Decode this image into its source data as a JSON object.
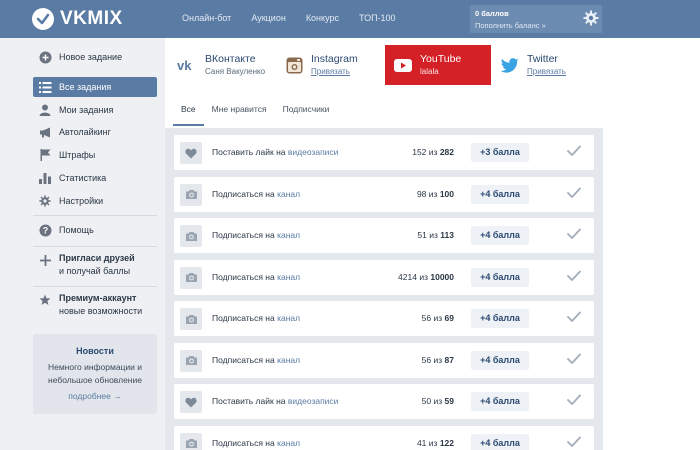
{
  "brand": {
    "name": "VKMIX",
    "color": "#5a7ba3"
  },
  "topnav": [
    "Онлайн-бот",
    "Аукцион",
    "Конкурс",
    "ТОП-100"
  ],
  "balance": {
    "title": "0 баллов",
    "link": "Пополнить баланс »"
  },
  "sidebar": {
    "items": [
      {
        "label": "Новое задание",
        "icon": "plus-circle-icon"
      },
      {
        "label": "Все задания",
        "icon": "list-icon",
        "active": true
      },
      {
        "label": "Мои задания",
        "icon": "user-icon"
      },
      {
        "label": "Автолайкинг",
        "icon": "megaphone-icon"
      },
      {
        "label": "Штрафы",
        "icon": "flag-icon"
      },
      {
        "label": "Статистика",
        "icon": "bar-chart-icon"
      },
      {
        "label": "Настройки",
        "icon": "gear-icon"
      }
    ],
    "help": "Помощь",
    "invite": {
      "title": "Пригласи друзей",
      "subtitle": "и получай баллы"
    },
    "premium": {
      "title": "Премиум-аккаунт",
      "subtitle": "новые возможности"
    },
    "news": {
      "title": "Новости",
      "text": "Немного информации и небольшое обновление",
      "more": "подробнее →"
    }
  },
  "platforms": [
    {
      "name": "ВКонтакте",
      "sub": "Саня Вакуленко",
      "icon": "vk-icon"
    },
    {
      "name": "Instagram",
      "sub": "Привязать",
      "icon": "instagram-icon"
    },
    {
      "name": "YouTube",
      "sub": "lalala",
      "icon": "youtube-icon",
      "active": true
    },
    {
      "name": "Twitter",
      "sub": "Привязать",
      "icon": "twitter-icon"
    }
  ],
  "filters": [
    "Все",
    "Мне нравится",
    "Подписчики"
  ],
  "tasks": [
    {
      "icon": "heart-icon",
      "action": "Поставить лайк на",
      "target": "видеозаписи",
      "done": "152",
      "sep": "из",
      "total": "282",
      "reward": "+3 балла"
    },
    {
      "icon": "camera-icon",
      "action": "Подписаться на",
      "target": "канал",
      "done": "98",
      "sep": "из",
      "total": "100",
      "reward": "+4 балла"
    },
    {
      "icon": "camera-icon",
      "action": "Подписаться на",
      "target": "канал",
      "done": "51",
      "sep": "из",
      "total": "113",
      "reward": "+4 балла"
    },
    {
      "icon": "camera-icon",
      "action": "Подписаться на",
      "target": "канал",
      "done": "4214",
      "sep": "из",
      "total": "10000",
      "reward": "+4 балла"
    },
    {
      "icon": "camera-icon",
      "action": "Подписаться на",
      "target": "канал",
      "done": "56",
      "sep": "из",
      "total": "69",
      "reward": "+4 балла"
    },
    {
      "icon": "camera-icon",
      "action": "Подписаться на",
      "target": "канал",
      "done": "56",
      "sep": "из",
      "total": "87",
      "reward": "+4 балла"
    },
    {
      "icon": "heart-icon",
      "action": "Поставить лайк на",
      "target": "видеозаписи",
      "done": "50",
      "sep": "из",
      "total": "59",
      "reward": "+4 балла"
    },
    {
      "icon": "camera-icon",
      "action": "Подписаться на",
      "target": "канал",
      "done": "41",
      "sep": "из",
      "total": "122",
      "reward": "+4 балла"
    }
  ]
}
